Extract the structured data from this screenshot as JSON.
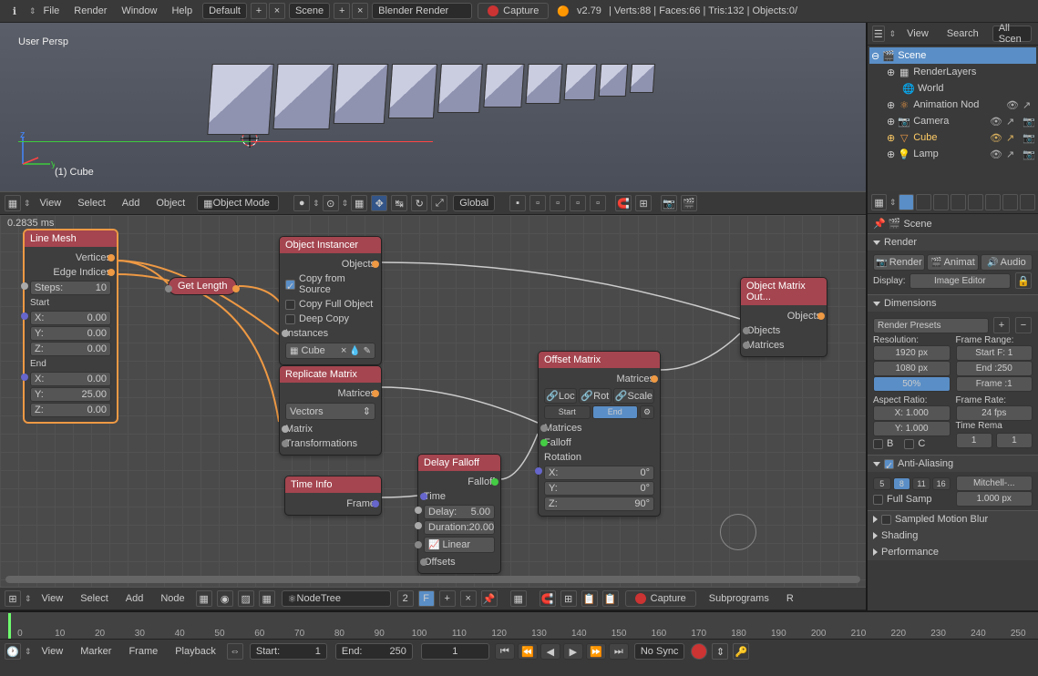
{
  "topbar": {
    "menus": [
      "File",
      "Render",
      "Window",
      "Help"
    ],
    "layout": "Default",
    "scene": "Scene",
    "engine": "Blender Render",
    "capture": "Capture",
    "version": "v2.79",
    "stats": "Verts:88 | Faces:66 | Tris:132 | Objects:0/"
  },
  "viewport": {
    "persp": "User Persp",
    "object": "(1) Cube",
    "header": {
      "menus": [
        "View",
        "Select",
        "Add",
        "Object"
      ],
      "mode": "Object Mode",
      "orientation": "Global"
    }
  },
  "nodes": {
    "ms": "0.2835 ms",
    "line_mesh": {
      "title": "Line Mesh",
      "outs": [
        "Vertices",
        "Edge Indices"
      ],
      "steps_label": "Steps:",
      "steps": "10",
      "start": "Start",
      "end": "End",
      "start_x": "0.00",
      "start_y": "0.00",
      "start_z": "0.00",
      "end_x": "0.00",
      "end_y": "25.00",
      "end_z": "0.00"
    },
    "get_length": "Get Length",
    "object_instancer": {
      "title": "Object Instancer",
      "out": "Objects",
      "copy_from_source": "Copy from Source",
      "copy_full": "Copy Full Object",
      "deep_copy": "Deep Copy",
      "instances": "Instances",
      "obj": "Cube"
    },
    "replicate_matrix": {
      "title": "Replicate Matrix",
      "out": "Matrices",
      "dropdown": "Vectors",
      "ins": [
        "Matrix",
        "Transformations"
      ]
    },
    "time_info": {
      "title": "Time Info",
      "out": "Frame"
    },
    "delay_falloff": {
      "title": "Delay Falloff",
      "out": "Falloff",
      "time": "Time",
      "delay_label": "Delay:",
      "delay": "5.00",
      "duration_label": "Duration:",
      "duration": "20.00",
      "interp": "Linear",
      "offsets": "Offsets"
    },
    "offset_matrix": {
      "title": "Offset Matrix",
      "out": "Matrices",
      "tabs": [
        "Loc",
        "Rot",
        "Scale"
      ],
      "start_end": [
        "Start",
        "End"
      ],
      "ins": [
        "Matrices",
        "Falloff",
        "Rotation"
      ],
      "rx": "0°",
      "ry": "0°",
      "rz": "90°"
    },
    "matrix_out": {
      "title": "Object Matrix Out...",
      "out": "Objects",
      "ins": [
        "Objects",
        "Matrices"
      ]
    },
    "header": {
      "menus": [
        "View",
        "Select",
        "Add",
        "Node"
      ],
      "tree": "NodeTree",
      "users": "2",
      "capture": "Capture",
      "subprograms": "Subprograms",
      "r": "R"
    }
  },
  "outliner": {
    "menus": [
      "View",
      "Search"
    ],
    "all": "All Scen",
    "items": [
      {
        "name": "Scene",
        "icon": "scene",
        "sel": true,
        "depth": 0
      },
      {
        "name": "RenderLayers",
        "icon": "layers",
        "depth": 1
      },
      {
        "name": "World",
        "icon": "world",
        "depth": 2
      },
      {
        "name": "Animation Nod",
        "icon": "anim",
        "depth": 1,
        "tog": true
      },
      {
        "name": "Camera",
        "icon": "camera",
        "depth": 1,
        "tog": true
      },
      {
        "name": "Cube",
        "icon": "mesh",
        "depth": 1,
        "tog": true,
        "hl": true
      },
      {
        "name": "Lamp",
        "icon": "lamp",
        "depth": 1,
        "tog": true
      }
    ]
  },
  "props": {
    "context": "Scene",
    "render": {
      "title": "Render",
      "buttons": [
        "Render",
        "Animat",
        "Audio"
      ],
      "display_label": "Display:",
      "display": "Image Editor"
    },
    "dimensions": {
      "title": "Dimensions",
      "preset": "Render Presets",
      "res_label": "Resolution:",
      "res_x": "1920 px",
      "res_y": "1080 px",
      "res_pct": "50%",
      "fr_label": "Frame Range:",
      "start": "Start F: 1",
      "end": "End :250",
      "step": "Frame :1",
      "ar_label": "Aspect Ratio:",
      "ar_x": "X: 1.000",
      "ar_y": "Y: 1.000",
      "b": "B",
      "c": "C",
      "fps_label": "Frame Rate:",
      "fps": "24 fps",
      "remap": "Time Rema",
      "remap1": "1",
      "remap2": "1"
    },
    "aa": {
      "title": "Anti-Aliasing",
      "samples": [
        "5",
        "8",
        "11",
        "16"
      ],
      "filter": "Mitchell-...",
      "full": "Full Samp",
      "size": "1.000 px"
    },
    "motion_blur": "Sampled Motion Blur",
    "shading": "Shading",
    "performance": "Performance"
  },
  "timeline": {
    "menus": [
      "View",
      "Marker",
      "Frame",
      "Playback"
    ],
    "start_label": "Start:",
    "start": "1",
    "end_label": "End:",
    "end": "250",
    "frame": "1",
    "sync": "No Sync",
    "ticks": [
      "0",
      "10",
      "20",
      "30",
      "40",
      "50",
      "60",
      "70",
      "80",
      "90",
      "100",
      "110",
      "120",
      "130",
      "140",
      "150",
      "160",
      "170",
      "180",
      "190",
      "200",
      "210",
      "220",
      "230",
      "240",
      "250"
    ]
  }
}
